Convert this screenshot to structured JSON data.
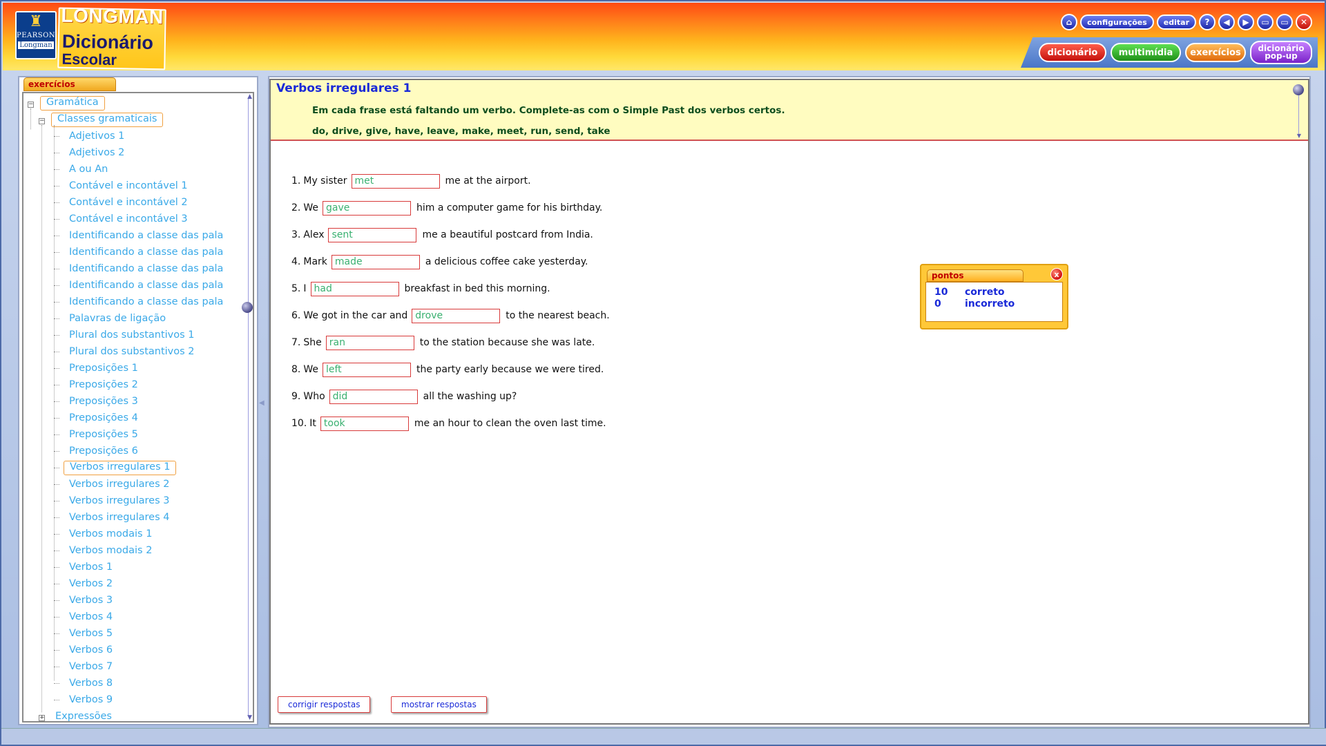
{
  "app": {
    "pearson_label": "PEARSON",
    "longman_small": "Longman",
    "brand_title": "LONGMAN",
    "product_line1": "Dicionário",
    "product_line2": "Escolar"
  },
  "top_controls": {
    "settings_label": "configurações",
    "edit_label": "editar",
    "help_label": "?",
    "back_label": "◀",
    "forward_label": "▶",
    "minimize_label": "▭",
    "maximize_label": "▭",
    "close_label": "✕",
    "home_label": "⌂"
  },
  "nav_tabs": {
    "dicionario": "dicionário",
    "multimidia": "multimídia",
    "exercicios": "exercícios",
    "popup_line1": "dicionário",
    "popup_line2": "pop-up"
  },
  "sidebar": {
    "tab_label": "exercícios",
    "root": "Gramática",
    "group": "Classes gramaticais",
    "items": [
      "Adjetivos 1",
      "Adjetivos 2",
      "A ou An",
      "Contável e incontável 1",
      "Contável e incontável 2",
      "Contável e incontável 3",
      "Identificando a classe das pala",
      "Identificando a classe das pala",
      "Identificando a classe das pala",
      "Identificando a classe das pala",
      "Identificando a classe das pala",
      "Palavras de ligação",
      "Plural dos substantivos 1",
      "Plural dos substantivos 2",
      "Preposições 1",
      "Preposições 2",
      "Preposições 3",
      "Preposições 4",
      "Preposições 5",
      "Preposições 6",
      "Verbos irregulares 1",
      "Verbos irregulares 2",
      "Verbos irregulares 3",
      "Verbos irregulares 4",
      "Verbos modais 1",
      "Verbos modais 2",
      "Verbos 1",
      "Verbos 2",
      "Verbos 3",
      "Verbos 4",
      "Verbos 5",
      "Verbos 6",
      "Verbos 7",
      "Verbos 8",
      "Verbos 9"
    ],
    "selected_index": 20,
    "last_root": "Expressões"
  },
  "exercise": {
    "title": "Verbos irregulares 1",
    "instruction": "Em cada frase está faltando um verbo. Complete-as com o Simple Past dos verbos certos.",
    "word_bank": "do, drive, give, have, leave, make, meet, run, send, take",
    "questions": [
      {
        "num": "1.",
        "before": "My sister",
        "answer": "met",
        "after": "me at the airport."
      },
      {
        "num": "2.",
        "before": "We",
        "answer": "gave",
        "after": "him a computer game for his birthday."
      },
      {
        "num": "3.",
        "before": "Alex",
        "answer": "sent",
        "after": "me a beautiful postcard from India."
      },
      {
        "num": "4.",
        "before": "Mark",
        "answer": "made",
        "after": "a delicious coffee cake yesterday."
      },
      {
        "num": "5.",
        "before": "I",
        "answer": "had",
        "after": "breakfast in bed this morning."
      },
      {
        "num": "6.",
        "before": "We got in the car and",
        "answer": "drove",
        "after": "to the nearest beach."
      },
      {
        "num": "7.",
        "before": "She",
        "answer": "ran",
        "after": "to the station because she was late."
      },
      {
        "num": "8.",
        "before": "We",
        "answer": "left",
        "after": "the party early because we were tired."
      },
      {
        "num": "9.",
        "before": "Who",
        "answer": "did",
        "after": "all the washing up?"
      },
      {
        "num": "10.",
        "before": "It",
        "answer": "took",
        "after": "me an hour to clean the oven last time."
      }
    ],
    "check_button": "corrigir respostas",
    "show_button": "mostrar respostas"
  },
  "score": {
    "tab_label": "pontos",
    "correct_value": "10",
    "correct_label": "correto",
    "incorrect_value": "0",
    "incorrect_label": "incorreto",
    "close_label": "x"
  }
}
